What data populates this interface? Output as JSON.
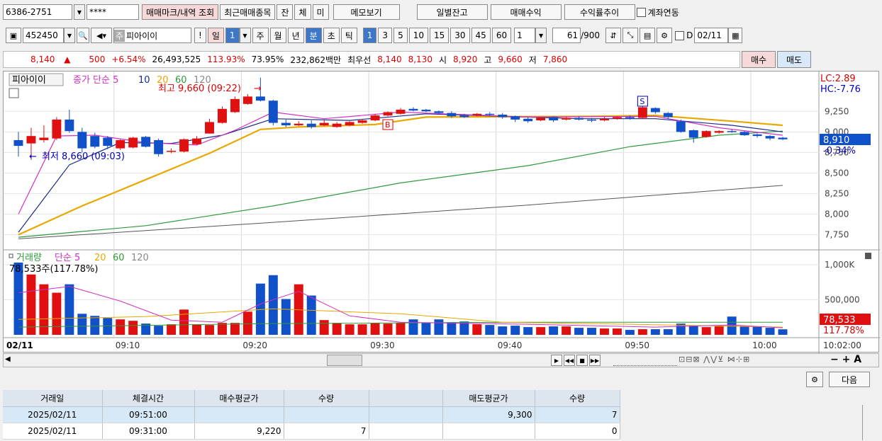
{
  "toolbar1": {
    "account": "6386-2751",
    "password": "****",
    "btn_trade_mark": "매매마크/내역 조회",
    "btn_recent": "최근매매종목",
    "btn_jan": "잔",
    "btn_che": "체",
    "btn_mi": "미",
    "btn_memo": "메모보기",
    "btn_daily": "일별잔고",
    "btn_profit": "매매수익",
    "btn_rate": "수익률추이",
    "link_label": "계좌연동"
  },
  "toolbar2": {
    "code": "452450",
    "stock_tag": "주",
    "stock_name": "피아이이",
    "btn_excl": "!",
    "period_day": "일",
    "period_day_num": "1",
    "period_week": "주",
    "period_month": "월",
    "period_year": "년",
    "period_min": "분",
    "period_sec": "초",
    "period_tick": "틱",
    "intervals": [
      "1",
      "3",
      "5",
      "10",
      "15",
      "30",
      "45",
      "60"
    ],
    "interval_value": "1",
    "count": "61",
    "count_total": "/900",
    "date_label": "D",
    "date": "02/11"
  },
  "quote": {
    "price": "8,140",
    "change": "500",
    "change_pct": "+6.54%",
    "volume": "26,493,525",
    "vol_ratio1": "113.93%",
    "vol_ratio2": "73.95%",
    "amount": "232,862백만",
    "best_label": "최우선",
    "ask": "8,140",
    "bid": "8,130",
    "open_label": "시",
    "open": "8,920",
    "high_label": "고",
    "high": "9,660",
    "low_label": "저",
    "low": "7,860",
    "buy_btn": "매수",
    "sell_btn": "매도"
  },
  "chart_legend": {
    "name": "피아이이",
    "price_ma": "종가 단순",
    "ma": [
      "5",
      "10",
      "20",
      "60",
      "120"
    ],
    "high_note": "최고 9,660 (09:22)",
    "low_note": "최저 8,660 (09:03)",
    "lc": "LC:2.89",
    "hc": "HC:-7.76",
    "cur_price": "8,910",
    "cur_pct": "-0.34%",
    "vol_title": "거래량",
    "vol_ma": "단순",
    "vol_ma_list": [
      "5",
      "20",
      "60",
      "120"
    ],
    "vol_note": "78,533주(117.78%)",
    "vol_cur": "78,533",
    "vol_cur_pct": "117.78%",
    "marker_s": "S",
    "marker_b": "B",
    "date_label": "02/11",
    "time_end": "10:02:00"
  },
  "chart_data": {
    "type": "candlestick",
    "x_ticks": [
      "09:10",
      "09:20",
      "09:30",
      "09:40",
      "09:50",
      "10:00"
    ],
    "y_ticks": [
      7750,
      8000,
      8250,
      8500,
      8750,
      9000,
      9250
    ],
    "y_tick_labels": [
      "7,750",
      "8,000",
      "8,250",
      "8,500",
      "8,750",
      "9,000",
      "9,250"
    ],
    "ylim": [
      7600,
      9700
    ],
    "vol_ticks": [
      500000,
      1000000
    ],
    "vol_tick_labels": [
      "500,000",
      "1,000K"
    ],
    "vol_ylim": [
      0,
      1150000
    ],
    "candles": [
      {
        "o": 8900,
        "c": 8830,
        "h": 9000,
        "l": 8700
      },
      {
        "o": 8860,
        "c": 8950,
        "h": 9050,
        "l": 8660
      },
      {
        "o": 8900,
        "c": 8930,
        "h": 9080,
        "l": 8870
      },
      {
        "o": 8920,
        "c": 9150,
        "h": 9180,
        "l": 8900
      },
      {
        "o": 9150,
        "c": 9010,
        "h": 9270,
        "l": 8990
      },
      {
        "o": 9000,
        "c": 8800,
        "h": 9050,
        "l": 8750
      },
      {
        "o": 8950,
        "c": 8820,
        "h": 8990,
        "l": 8800
      },
      {
        "o": 8930,
        "c": 8830,
        "h": 8950,
        "l": 8790
      },
      {
        "o": 8800,
        "c": 8900,
        "h": 8910,
        "l": 8780
      },
      {
        "o": 8810,
        "c": 8930,
        "h": 8940,
        "l": 8800
      },
      {
        "o": 8940,
        "c": 8820,
        "h": 8950,
        "l": 8810
      },
      {
        "o": 8900,
        "c": 8730,
        "h": 8920,
        "l": 8700
      },
      {
        "o": 8760,
        "c": 8770,
        "h": 8800,
        "l": 8740
      },
      {
        "o": 8760,
        "c": 8910,
        "h": 8920,
        "l": 8750
      },
      {
        "o": 8850,
        "c": 8920,
        "h": 8950,
        "l": 8840
      },
      {
        "o": 8980,
        "c": 9120,
        "h": 9160,
        "l": 8980
      },
      {
        "o": 9110,
        "c": 9280,
        "h": 9310,
        "l": 9100
      },
      {
        "o": 9240,
        "c": 9400,
        "h": 9430,
        "l": 9230
      },
      {
        "o": 9340,
        "c": 9430,
        "h": 9460,
        "l": 9330
      },
      {
        "o": 9430,
        "c": 9380,
        "h": 9660,
        "l": 9370
      },
      {
        "o": 9380,
        "c": 9110,
        "h": 9390,
        "l": 9080
      },
      {
        "o": 9110,
        "c": 9080,
        "h": 9150,
        "l": 9060
      },
      {
        "o": 9080,
        "c": 9100,
        "h": 9130,
        "l": 9070
      },
      {
        "o": 9100,
        "c": 9060,
        "h": 9140,
        "l": 9040
      },
      {
        "o": 9080,
        "c": 9110,
        "h": 9140,
        "l": 9070
      },
      {
        "o": 9060,
        "c": 9100,
        "h": 9120,
        "l": 9050
      },
      {
        "o": 9080,
        "c": 9120,
        "h": 9130,
        "l": 9070
      },
      {
        "o": 9110,
        "c": 9140,
        "h": 9160,
        "l": 9100
      },
      {
        "o": 9140,
        "c": 9200,
        "h": 9220,
        "l": 9130
      },
      {
        "o": 9200,
        "c": 9240,
        "h": 9250,
        "l": 9190
      },
      {
        "o": 9220,
        "c": 9270,
        "h": 9290,
        "l": 9210
      },
      {
        "o": 9280,
        "c": 9260,
        "h": 9300,
        "l": 9250
      },
      {
        "o": 9270,
        "c": 9250,
        "h": 9280,
        "l": 9240
      },
      {
        "o": 9250,
        "c": 9230,
        "h": 9260,
        "l": 9220
      },
      {
        "o": 9230,
        "c": 9190,
        "h": 9250,
        "l": 9170
      },
      {
        "o": 9200,
        "c": 9180,
        "h": 9220,
        "l": 9170
      },
      {
        "o": 9200,
        "c": 9220,
        "h": 9230,
        "l": 9190
      },
      {
        "o": 9220,
        "c": 9210,
        "h": 9240,
        "l": 9190
      },
      {
        "o": 9210,
        "c": 9180,
        "h": 9230,
        "l": 9160
      },
      {
        "o": 9190,
        "c": 9150,
        "h": 9200,
        "l": 9120
      },
      {
        "o": 9160,
        "c": 9130,
        "h": 9180,
        "l": 9110
      },
      {
        "o": 9140,
        "c": 9170,
        "h": 9180,
        "l": 9130
      },
      {
        "o": 9180,
        "c": 9140,
        "h": 9190,
        "l": 9120
      },
      {
        "o": 9150,
        "c": 9170,
        "h": 9180,
        "l": 9140
      },
      {
        "o": 9170,
        "c": 9150,
        "h": 9190,
        "l": 9140
      },
      {
        "o": 9150,
        "c": 9140,
        "h": 9170,
        "l": 9120
      },
      {
        "o": 9140,
        "c": 9160,
        "h": 9180,
        "l": 9130
      },
      {
        "o": 9160,
        "c": 9180,
        "h": 9190,
        "l": 9150
      },
      {
        "o": 9180,
        "c": 9170,
        "h": 9200,
        "l": 9150
      },
      {
        "o": 9170,
        "c": 9300,
        "h": 9330,
        "l": 9160
      },
      {
        "o": 9290,
        "c": 9240,
        "h": 9300,
        "l": 9220
      },
      {
        "o": 9230,
        "c": 9180,
        "h": 9240,
        "l": 9160
      },
      {
        "o": 9130,
        "c": 9000,
        "h": 9150,
        "l": 8990
      },
      {
        "o": 9020,
        "c": 8930,
        "h": 9030,
        "l": 8870
      },
      {
        "o": 8940,
        "c": 9010,
        "h": 9020,
        "l": 8930
      },
      {
        "o": 8990,
        "c": 9010,
        "h": 9020,
        "l": 8980
      },
      {
        "o": 9010,
        "c": 9000,
        "h": 9030,
        "l": 8990
      },
      {
        "o": 9000,
        "c": 8960,
        "h": 9010,
        "l": 8950
      },
      {
        "o": 8970,
        "c": 8950,
        "h": 8980,
        "l": 8930
      },
      {
        "o": 8950,
        "c": 8920,
        "h": 8960,
        "l": 8900
      },
      {
        "o": 8930,
        "c": 8910,
        "h": 8940,
        "l": 8900
      }
    ],
    "volume": [
      1030000,
      860000,
      720000,
      600000,
      720000,
      300000,
      270000,
      240000,
      220000,
      200000,
      160000,
      130000,
      150000,
      360000,
      150000,
      140000,
      170000,
      170000,
      330000,
      730000,
      850000,
      510000,
      720000,
      560000,
      210000,
      170000,
      150000,
      150000,
      170000,
      160000,
      170000,
      220000,
      170000,
      220000,
      180000,
      190000,
      150000,
      140000,
      120000,
      130000,
      110000,
      110000,
      120000,
      120000,
      100000,
      100000,
      90000,
      90000,
      70000,
      80000,
      80000,
      80000,
      160000,
      130000,
      110000,
      120000,
      260000,
      120000,
      120000,
      100000,
      78533
    ],
    "ma_price": {
      "pink": [
        [
          0,
          8000
        ],
        [
          3,
          8950
        ],
        [
          6,
          8960
        ],
        [
          10,
          8870
        ],
        [
          14,
          8840
        ],
        [
          17,
          9020
        ],
        [
          20,
          9240
        ],
        [
          24,
          9160
        ],
        [
          30,
          9240
        ],
        [
          40,
          9180
        ],
        [
          50,
          9190
        ],
        [
          55,
          9050
        ],
        [
          60,
          8960
        ]
      ],
      "navy": [
        [
          0,
          7780
        ],
        [
          4,
          8600
        ],
        [
          8,
          8870
        ],
        [
          12,
          8860
        ],
        [
          16,
          8960
        ],
        [
          20,
          9160
        ],
        [
          26,
          9140
        ],
        [
          32,
          9220
        ],
        [
          44,
          9160
        ],
        [
          50,
          9160
        ],
        [
          56,
          9080
        ],
        [
          60,
          9000
        ]
      ],
      "orange": [
        [
          0,
          7750
        ],
        [
          5,
          8100
        ],
        [
          10,
          8420
        ],
        [
          15,
          8740
        ],
        [
          19,
          9030
        ],
        [
          22,
          9060
        ],
        [
          28,
          9090
        ],
        [
          32,
          9180
        ],
        [
          45,
          9190
        ],
        [
          50,
          9200
        ],
        [
          56,
          9130
        ],
        [
          60,
          9080
        ]
      ],
      "green": [
        [
          0,
          7720
        ],
        [
          10,
          7860
        ],
        [
          20,
          8100
        ],
        [
          30,
          8380
        ],
        [
          40,
          8590
        ],
        [
          48,
          8820
        ],
        [
          55,
          8960
        ],
        [
          60,
          9010
        ]
      ],
      "gray": [
        [
          0,
          7700
        ],
        [
          20,
          7900
        ],
        [
          40,
          8110
        ],
        [
          60,
          8350
        ]
      ]
    },
    "ma_vol": {
      "pink": [
        [
          0,
          600000
        ],
        [
          4,
          690000
        ],
        [
          8,
          480000
        ],
        [
          12,
          210000
        ],
        [
          16,
          180000
        ],
        [
          19,
          440000
        ],
        [
          22,
          620000
        ],
        [
          26,
          270000
        ],
        [
          30,
          180000
        ],
        [
          40,
          150000
        ],
        [
          50,
          110000
        ],
        [
          56,
          140000
        ],
        [
          60,
          100000
        ]
      ],
      "orange": [
        [
          0,
          220000
        ],
        [
          10,
          260000
        ],
        [
          20,
          370000
        ],
        [
          30,
          300000
        ],
        [
          38,
          180000
        ],
        [
          48,
          150000
        ],
        [
          60,
          110000
        ]
      ],
      "green": [
        [
          0,
          110000
        ],
        [
          20,
          160000
        ],
        [
          40,
          180000
        ],
        [
          60,
          180000
        ]
      ]
    }
  },
  "scroll_icons": [
    "play-icon",
    "prev-icon",
    "stop-icon",
    "next-icon"
  ],
  "right_tools": {
    "gear": "⚙",
    "next_btn": "다음"
  },
  "trades_table": {
    "headers": [
      "거래일",
      "체결시간",
      "매수평균가",
      "수량",
      "",
      "매도평균가",
      "수량"
    ],
    "rows": [
      [
        "2025/02/11",
        "09:51:00",
        "",
        "",
        "",
        "9,300",
        "7"
      ],
      [
        "2025/02/11",
        "09:31:00",
        "9,220",
        "7",
        "",
        "",
        "0"
      ]
    ]
  }
}
